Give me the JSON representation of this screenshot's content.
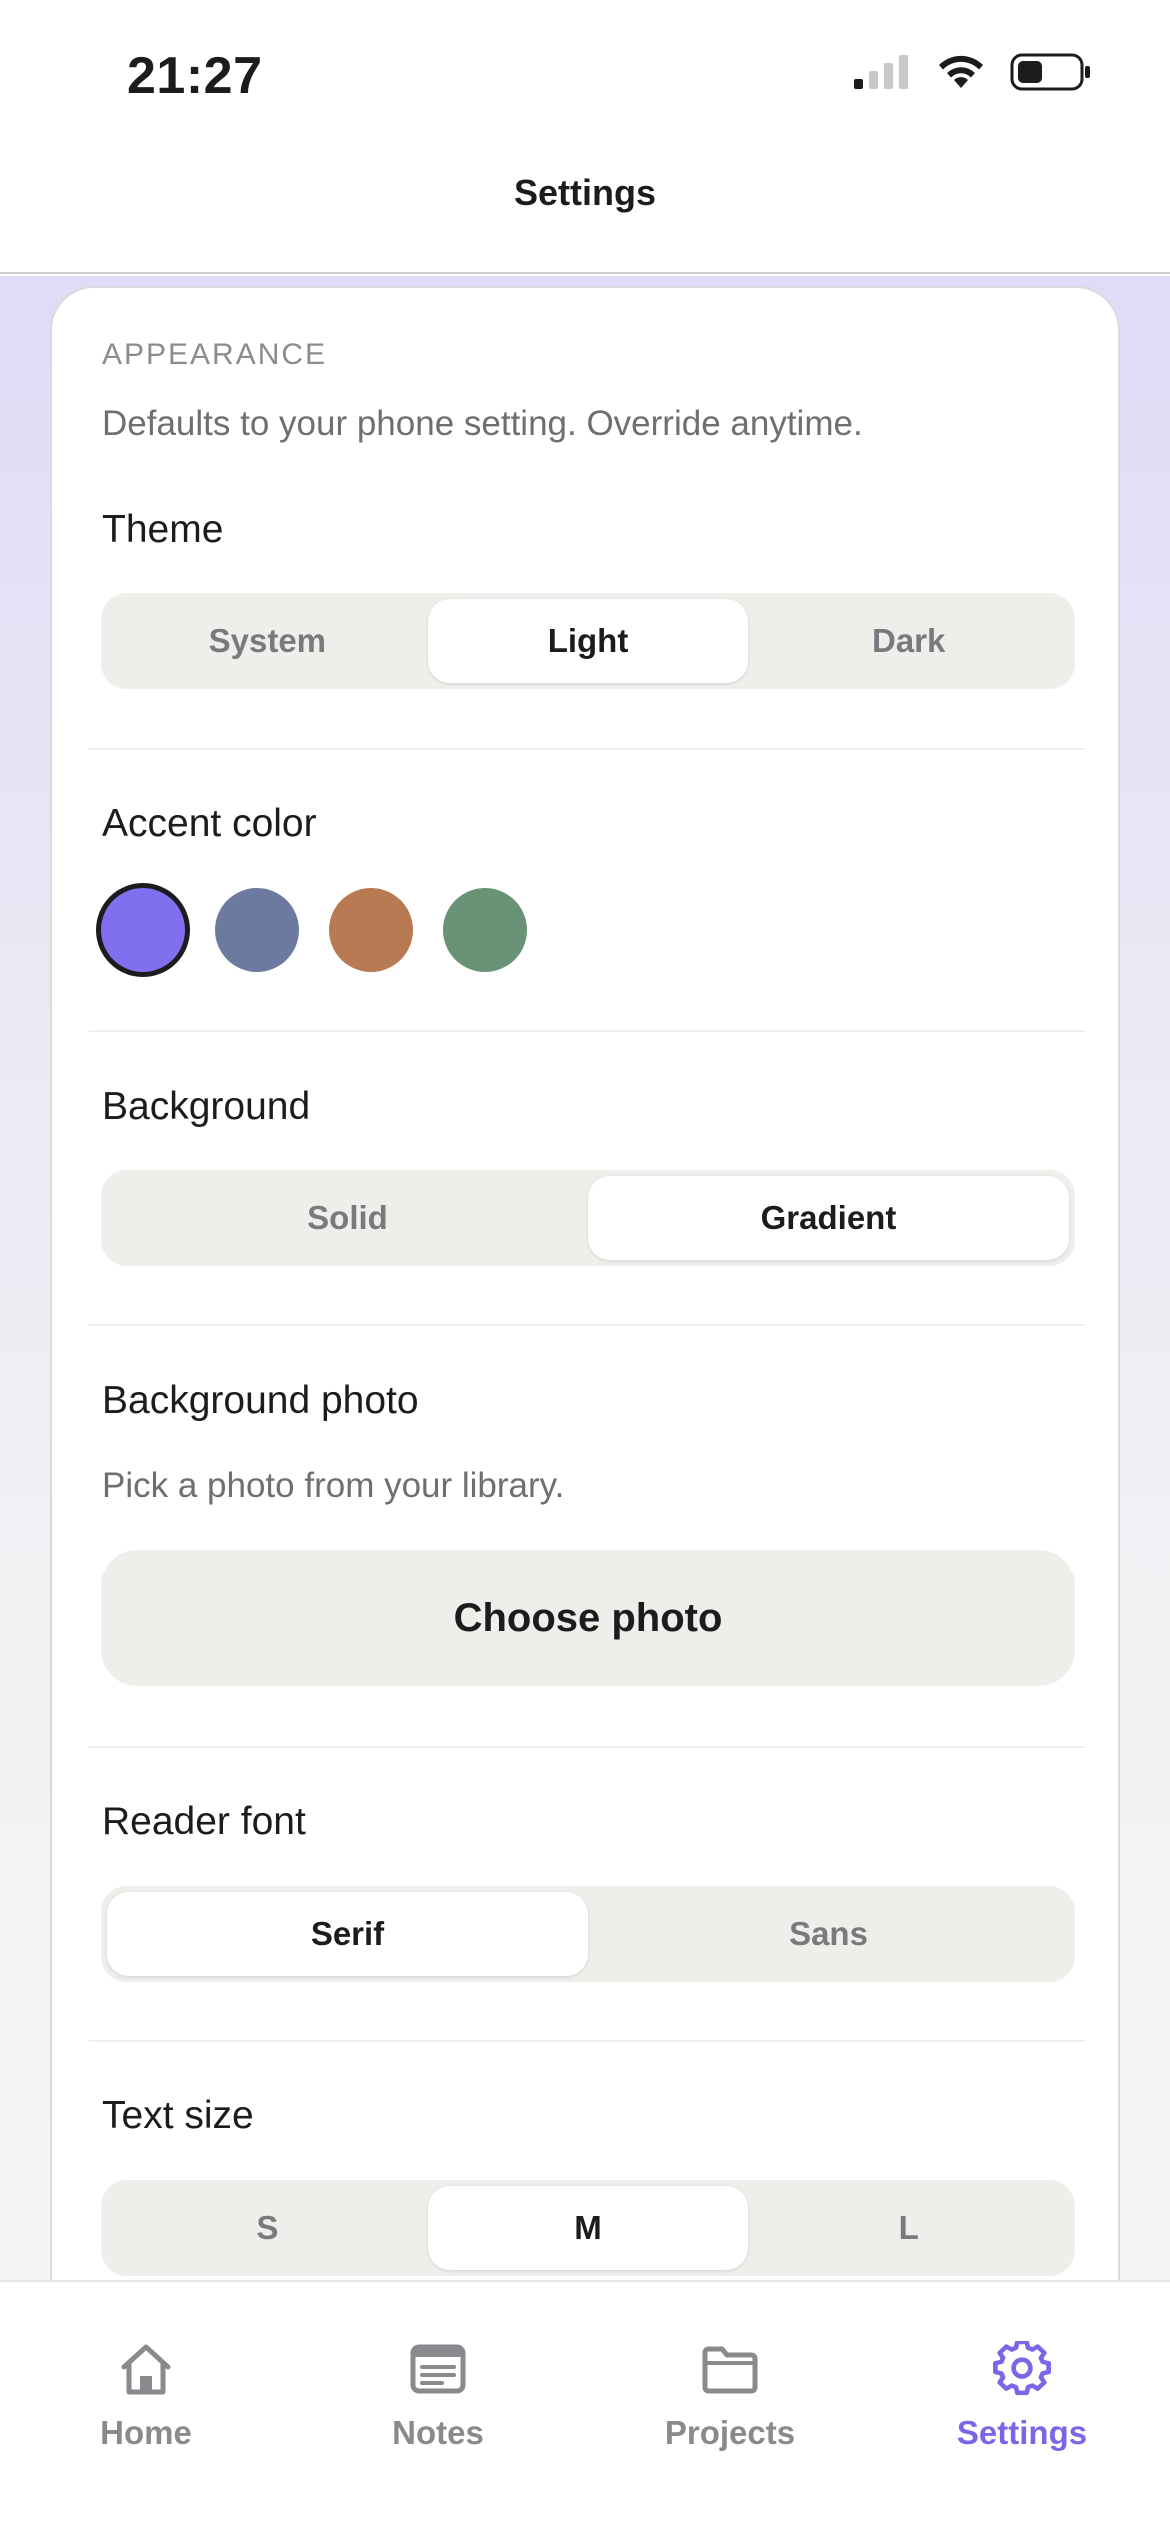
{
  "status_bar": {
    "time": "21:27",
    "icons": [
      "cellular-signal-icon",
      "wifi-icon",
      "battery-icon"
    ]
  },
  "header": {
    "title": "Settings"
  },
  "appearance": {
    "overline": "APPEARANCE",
    "helper": "Defaults to your phone setting. Override anytime."
  },
  "theme": {
    "title": "Theme",
    "options": [
      "System",
      "Light",
      "Dark"
    ],
    "selected": "Light"
  },
  "accent": {
    "title": "Accent color",
    "colors": [
      "#8070f0",
      "#6b7a9e",
      "#b87a52",
      "#6a9276"
    ],
    "selected_index": 0
  },
  "background": {
    "title": "Background",
    "options": [
      "Solid",
      "Gradient"
    ],
    "selected": "Gradient"
  },
  "background_photo": {
    "title": "Background photo",
    "helper": "Pick a photo from your library.",
    "button_label": "Choose photo"
  },
  "reader_font": {
    "title": "Reader font",
    "options": [
      "Serif",
      "Sans"
    ],
    "selected": "Serif"
  },
  "text_size": {
    "title": "Text size",
    "options": [
      "S",
      "M",
      "L"
    ],
    "selected": "M"
  },
  "tab_bar": {
    "items": [
      {
        "label": "Home",
        "icon": "home-icon"
      },
      {
        "label": "Notes",
        "icon": "notes-icon"
      },
      {
        "label": "Projects",
        "icon": "folder-icon"
      },
      {
        "label": "Settings",
        "icon": "gear-icon"
      }
    ],
    "active_index": 3,
    "accent": "#7a67e6"
  }
}
